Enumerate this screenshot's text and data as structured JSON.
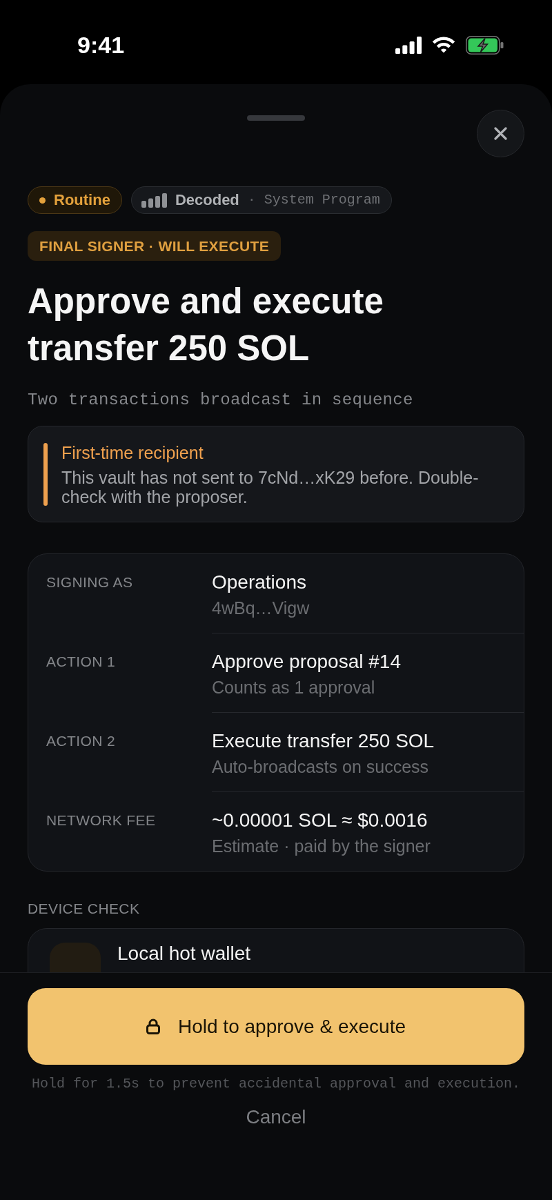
{
  "status_bar": {
    "time": "9:41"
  },
  "badges": [
    {
      "kind": "risk",
      "label": "Routine"
    },
    {
      "kind": "decoder",
      "label": "Decoded",
      "separator": "·",
      "detail": "System Program"
    }
  ],
  "role_tag": "FINAL SIGNER · WILL EXECUTE",
  "title": "Approve and execute transfer 250 SOL",
  "subtitle": "Two transactions broadcast in sequence",
  "alert": {
    "title": "First-time recipient",
    "body": "This vault has not sent to 7cNd…xK29 before. Double-check with the proposer."
  },
  "details": [
    {
      "label": "SIGNING AS",
      "value": "Operations",
      "note": "4wBq…Vigw"
    },
    {
      "label": "ACTION 1",
      "value": "Approve proposal #14",
      "note": "Counts as 1 approval"
    },
    {
      "label": "ACTION 2",
      "value": "Execute transfer 250 SOL",
      "note": "Auto-broadcasts on success"
    },
    {
      "label": "NETWORK FEE",
      "value": "~0.00001 SOL ≈ $0.0016",
      "note": "Estimate · paid by the signer"
    }
  ],
  "device_check": {
    "heading": "DEVICE CHECK",
    "device": "Local hot wallet"
  },
  "primary_action": {
    "label": "Hold to approve & execute"
  },
  "hint": "Hold for 1.5s to prevent accidental approval and execution.",
  "cancel": {
    "label": "Cancel"
  }
}
